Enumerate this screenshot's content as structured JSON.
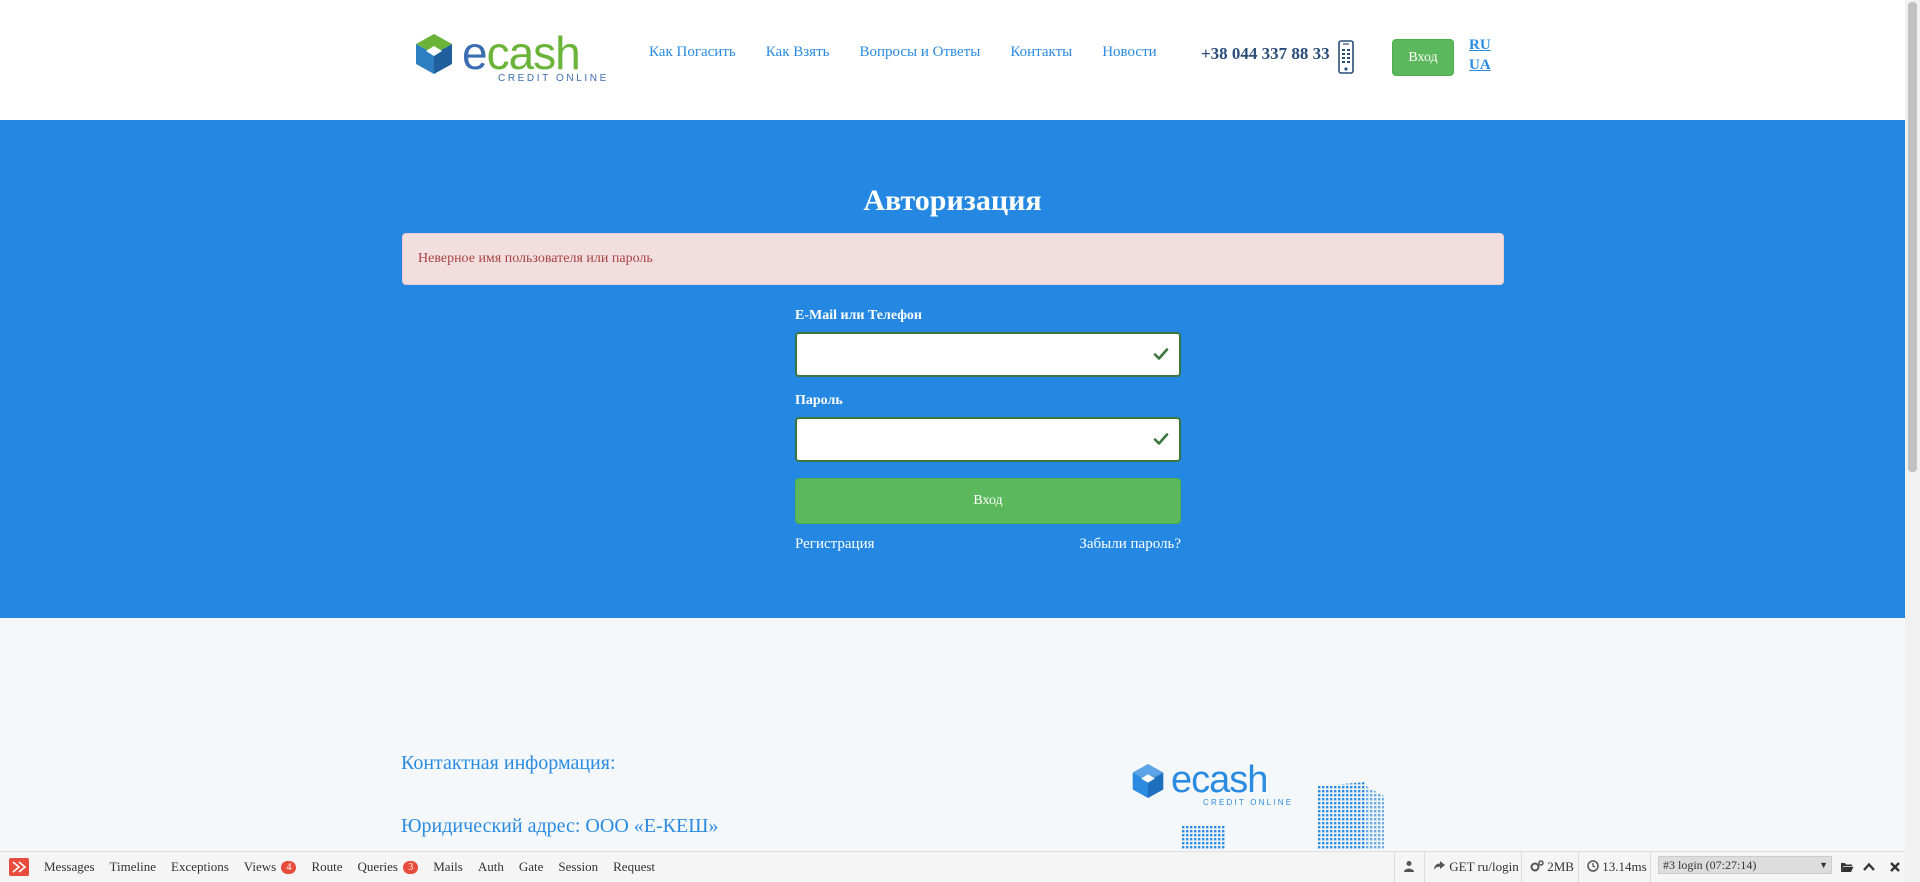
{
  "header": {
    "logo": {
      "main": "e",
      "accent": "cash",
      "tagline": "CREDIT ONLINE"
    },
    "nav": [
      "Как Погасить",
      "Как Взять",
      "Вопросы и Ответы",
      "Контакты",
      "Новости"
    ],
    "phone": "+38 044 337 88 33",
    "login_button": "Вход",
    "languages": [
      "RU",
      "UA"
    ]
  },
  "auth": {
    "title": "Авторизация",
    "error": "Неверное имя пользователя или пароль",
    "login_label": "E-Mail или Телефон",
    "login_value": "",
    "password_label": "Пароль",
    "password_value": "",
    "submit": "Вход",
    "register_link": "Регистрация",
    "forgot_link": "Забыли пароль?"
  },
  "footer": {
    "contact_title": "Контактная информация:",
    "address": "Юридический адрес: ООО «Е-КЕШ»"
  },
  "debugbar": {
    "tabs": [
      {
        "label": "Messages"
      },
      {
        "label": "Timeline"
      },
      {
        "label": "Exceptions"
      },
      {
        "label": "Views",
        "badge": "4"
      },
      {
        "label": "Route"
      },
      {
        "label": "Queries",
        "badge": "3"
      },
      {
        "label": "Mails"
      },
      {
        "label": "Auth"
      },
      {
        "label": "Gate"
      },
      {
        "label": "Session"
      },
      {
        "label": "Request"
      }
    ],
    "route": "GET ru/login",
    "memory": "2MB",
    "time": "13.14ms",
    "request_select": "#3 login (07:27:14)"
  },
  "colors": {
    "primary_blue": "#2488e2",
    "brand_green": "#5cb85c",
    "error_bg": "#f2dede",
    "error_text": "#a94442"
  }
}
